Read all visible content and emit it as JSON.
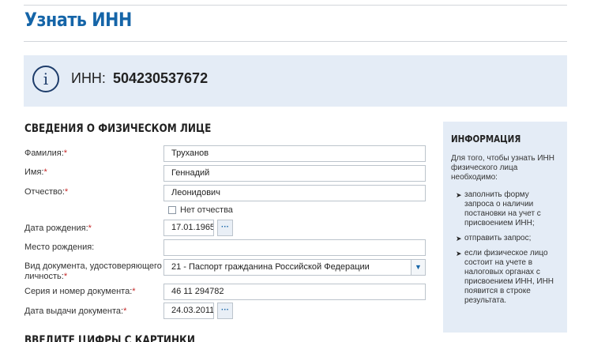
{
  "page": {
    "title": "Узнать ИНН"
  },
  "result": {
    "label": "ИНН:",
    "value": "504230537672",
    "icon": "info-icon"
  },
  "person": {
    "section_title": "СВЕДЕНИЯ О ФИЗИЧЕСКОМ ЛИЦЕ",
    "required_mark": "*",
    "surname": {
      "label": "Фамилия:",
      "value": "Труханов"
    },
    "name": {
      "label": "Имя:",
      "value": "Геннадий"
    },
    "patronymic": {
      "label": "Отчество:",
      "value": "Леонидович"
    },
    "no_patronymic": {
      "label": "Нет отчества",
      "checked": false
    },
    "birth_date": {
      "label": "Дата рождения:",
      "value": "17.01.1965",
      "button": "···"
    },
    "birth_place": {
      "label": "Место рождения:",
      "value": ""
    },
    "doc_type": {
      "label_line1": "Вид документа, удостоверяющего",
      "label_line2": "личность:",
      "value": "21 - Паспорт гражданина Российской Федерации",
      "arrow": "▼"
    },
    "doc_number": {
      "label": "Серия и номер документа:",
      "value": "46 11 294782"
    },
    "issue_date": {
      "label": "Дата выдачи документа:",
      "value": "24.03.2011",
      "button": "···"
    }
  },
  "captcha": {
    "section_title": "ВВЕДИТЕ ЦИФРЫ С КАРТИНКИ"
  },
  "info": {
    "title": "ИНФОРМАЦИЯ",
    "intro": "Для того, чтобы узнать ИНН физического лица необходимо:",
    "bullet": "➤",
    "items": [
      "заполнить форму запроса о наличии постановки на учет с присвоением ИНН;",
      "отправить запрос;",
      "если физическое лицо состоит на учете в налоговых органах с присвоением ИНН, ИНН появится в строке результата."
    ]
  }
}
